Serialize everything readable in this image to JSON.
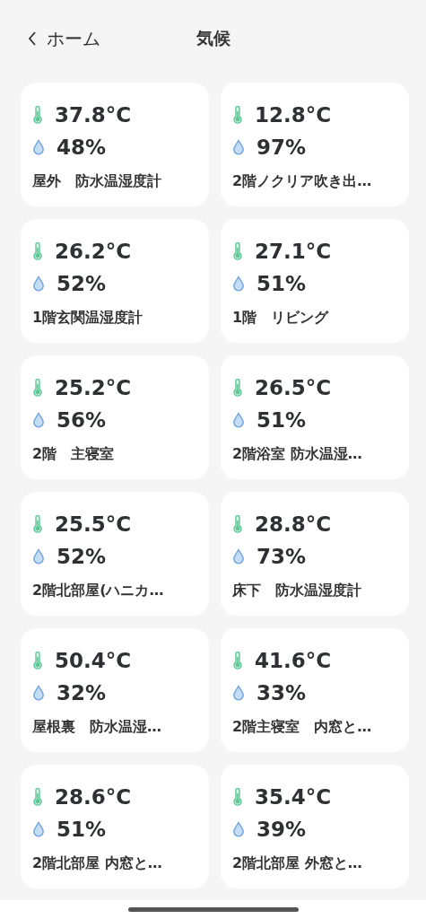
{
  "header": {
    "back_label": "ホーム",
    "title": "気候"
  },
  "sensors": [
    {
      "temperature": "37.8°C",
      "humidity": "48%",
      "name": "屋外　防水温湿度計"
    },
    {
      "temperature": "12.8°C",
      "humidity": "97%",
      "name": "2階ノクリア吹き出…"
    },
    {
      "temperature": "26.2°C",
      "humidity": "52%",
      "name": "1階玄関温湿度計"
    },
    {
      "temperature": "27.1°C",
      "humidity": "51%",
      "name": "1階　リビング"
    },
    {
      "temperature": "25.2°C",
      "humidity": "56%",
      "name": "2階　主寝室"
    },
    {
      "temperature": "26.5°C",
      "humidity": "51%",
      "name": "2階浴室 防水温湿…"
    },
    {
      "temperature": "25.5°C",
      "humidity": "52%",
      "name": "2階北部屋(ハニカ…"
    },
    {
      "temperature": "28.8°C",
      "humidity": "73%",
      "name": "床下　防水温湿度計"
    },
    {
      "temperature": "50.4°C",
      "humidity": "32%",
      "name": "屋根裏　防水温湿…"
    },
    {
      "temperature": "41.6°C",
      "humidity": "33%",
      "name": "2階主寝室　内窓と…"
    },
    {
      "temperature": "28.6°C",
      "humidity": "51%",
      "name": "2階北部屋 内窓と…"
    },
    {
      "temperature": "35.4°C",
      "humidity": "39%",
      "name": "2階北部屋 外窓と…"
    }
  ]
}
